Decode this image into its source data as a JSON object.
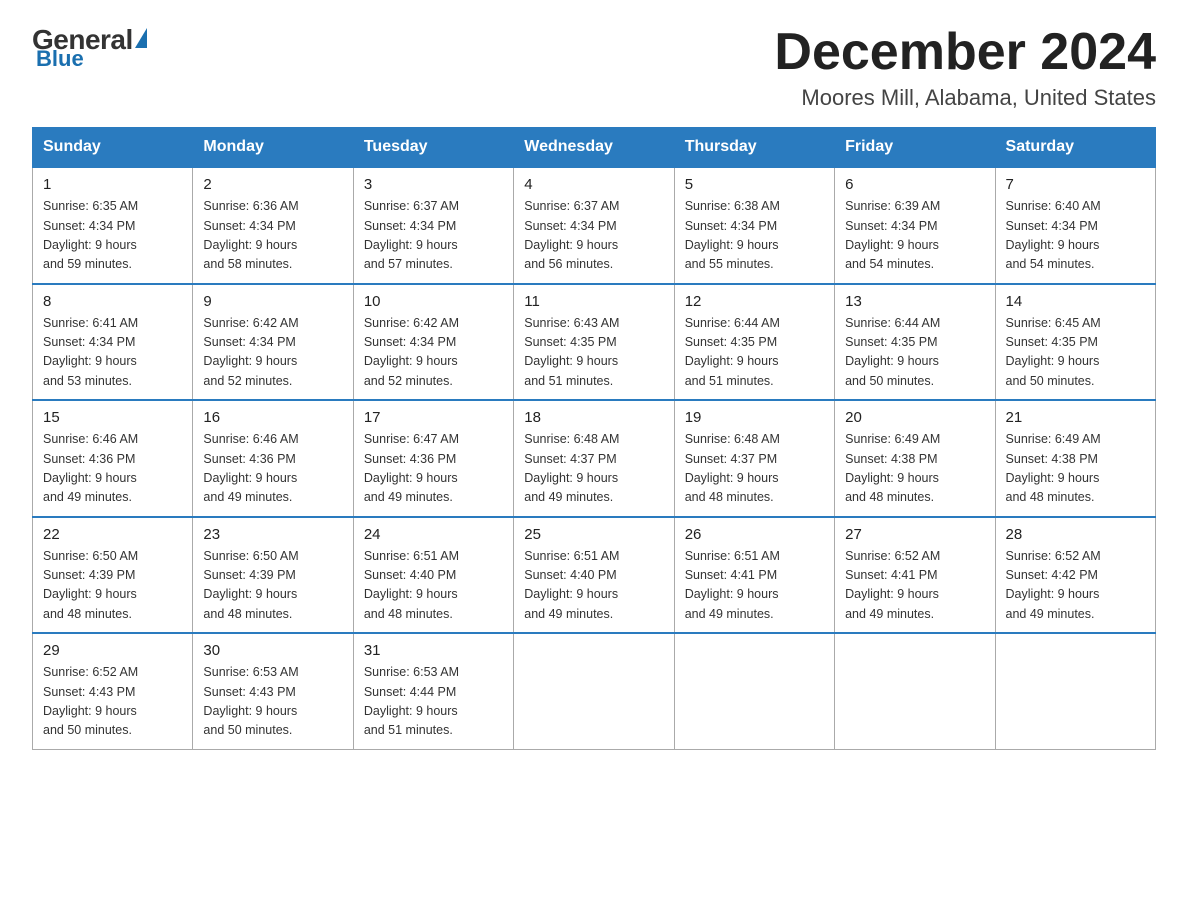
{
  "logo": {
    "general": "General",
    "blue": "Blue",
    "triangle_color": "#1a6faf"
  },
  "header": {
    "month_title": "December 2024",
    "location": "Moores Mill, Alabama, United States"
  },
  "weekdays": [
    "Sunday",
    "Monday",
    "Tuesday",
    "Wednesday",
    "Thursday",
    "Friday",
    "Saturday"
  ],
  "weeks": [
    [
      {
        "day": "1",
        "sunrise": "6:35 AM",
        "sunset": "4:34 PM",
        "daylight": "9 hours and 59 minutes."
      },
      {
        "day": "2",
        "sunrise": "6:36 AM",
        "sunset": "4:34 PM",
        "daylight": "9 hours and 58 minutes."
      },
      {
        "day": "3",
        "sunrise": "6:37 AM",
        "sunset": "4:34 PM",
        "daylight": "9 hours and 57 minutes."
      },
      {
        "day": "4",
        "sunrise": "6:37 AM",
        "sunset": "4:34 PM",
        "daylight": "9 hours and 56 minutes."
      },
      {
        "day": "5",
        "sunrise": "6:38 AM",
        "sunset": "4:34 PM",
        "daylight": "9 hours and 55 minutes."
      },
      {
        "day": "6",
        "sunrise": "6:39 AM",
        "sunset": "4:34 PM",
        "daylight": "9 hours and 54 minutes."
      },
      {
        "day": "7",
        "sunrise": "6:40 AM",
        "sunset": "4:34 PM",
        "daylight": "9 hours and 54 minutes."
      }
    ],
    [
      {
        "day": "8",
        "sunrise": "6:41 AM",
        "sunset": "4:34 PM",
        "daylight": "9 hours and 53 minutes."
      },
      {
        "day": "9",
        "sunrise": "6:42 AM",
        "sunset": "4:34 PM",
        "daylight": "9 hours and 52 minutes."
      },
      {
        "day": "10",
        "sunrise": "6:42 AM",
        "sunset": "4:34 PM",
        "daylight": "9 hours and 52 minutes."
      },
      {
        "day": "11",
        "sunrise": "6:43 AM",
        "sunset": "4:35 PM",
        "daylight": "9 hours and 51 minutes."
      },
      {
        "day": "12",
        "sunrise": "6:44 AM",
        "sunset": "4:35 PM",
        "daylight": "9 hours and 51 minutes."
      },
      {
        "day": "13",
        "sunrise": "6:44 AM",
        "sunset": "4:35 PM",
        "daylight": "9 hours and 50 minutes."
      },
      {
        "day": "14",
        "sunrise": "6:45 AM",
        "sunset": "4:35 PM",
        "daylight": "9 hours and 50 minutes."
      }
    ],
    [
      {
        "day": "15",
        "sunrise": "6:46 AM",
        "sunset": "4:36 PM",
        "daylight": "9 hours and 49 minutes."
      },
      {
        "day": "16",
        "sunrise": "6:46 AM",
        "sunset": "4:36 PM",
        "daylight": "9 hours and 49 minutes."
      },
      {
        "day": "17",
        "sunrise": "6:47 AM",
        "sunset": "4:36 PM",
        "daylight": "9 hours and 49 minutes."
      },
      {
        "day": "18",
        "sunrise": "6:48 AM",
        "sunset": "4:37 PM",
        "daylight": "9 hours and 49 minutes."
      },
      {
        "day": "19",
        "sunrise": "6:48 AM",
        "sunset": "4:37 PM",
        "daylight": "9 hours and 48 minutes."
      },
      {
        "day": "20",
        "sunrise": "6:49 AM",
        "sunset": "4:38 PM",
        "daylight": "9 hours and 48 minutes."
      },
      {
        "day": "21",
        "sunrise": "6:49 AM",
        "sunset": "4:38 PM",
        "daylight": "9 hours and 48 minutes."
      }
    ],
    [
      {
        "day": "22",
        "sunrise": "6:50 AM",
        "sunset": "4:39 PM",
        "daylight": "9 hours and 48 minutes."
      },
      {
        "day": "23",
        "sunrise": "6:50 AM",
        "sunset": "4:39 PM",
        "daylight": "9 hours and 48 minutes."
      },
      {
        "day": "24",
        "sunrise": "6:51 AM",
        "sunset": "4:40 PM",
        "daylight": "9 hours and 48 minutes."
      },
      {
        "day": "25",
        "sunrise": "6:51 AM",
        "sunset": "4:40 PM",
        "daylight": "9 hours and 49 minutes."
      },
      {
        "day": "26",
        "sunrise": "6:51 AM",
        "sunset": "4:41 PM",
        "daylight": "9 hours and 49 minutes."
      },
      {
        "day": "27",
        "sunrise": "6:52 AM",
        "sunset": "4:41 PM",
        "daylight": "9 hours and 49 minutes."
      },
      {
        "day": "28",
        "sunrise": "6:52 AM",
        "sunset": "4:42 PM",
        "daylight": "9 hours and 49 minutes."
      }
    ],
    [
      {
        "day": "29",
        "sunrise": "6:52 AM",
        "sunset": "4:43 PM",
        "daylight": "9 hours and 50 minutes."
      },
      {
        "day": "30",
        "sunrise": "6:53 AM",
        "sunset": "4:43 PM",
        "daylight": "9 hours and 50 minutes."
      },
      {
        "day": "31",
        "sunrise": "6:53 AM",
        "sunset": "4:44 PM",
        "daylight": "9 hours and 51 minutes."
      },
      null,
      null,
      null,
      null
    ]
  ],
  "labels": {
    "sunrise": "Sunrise:",
    "sunset": "Sunset:",
    "daylight": "Daylight:"
  }
}
